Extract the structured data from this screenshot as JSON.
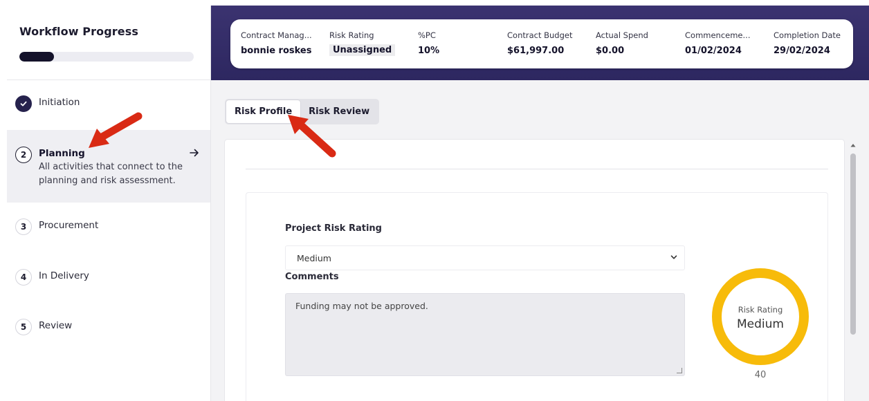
{
  "sidebar": {
    "title": "Workflow Progress",
    "progress_fraction": 0.2,
    "steps": [
      {
        "number": "1",
        "label": "Initiation",
        "state": "done"
      },
      {
        "number": "2",
        "label": "Planning",
        "state": "active",
        "description": "All activities that connect to the planning and risk assessment."
      },
      {
        "number": "3",
        "label": "Procurement",
        "state": "pending"
      },
      {
        "number": "4",
        "label": "In Delivery",
        "state": "pending"
      },
      {
        "number": "5",
        "label": "Review",
        "state": "pending"
      }
    ]
  },
  "header": {
    "fields": [
      {
        "label": "Contract Manag...",
        "value": "bonnie roskes"
      },
      {
        "label": "Risk Rating",
        "value": "Unassigned"
      },
      {
        "label": "%PC",
        "value": "10%"
      },
      {
        "label": "Contract Budget",
        "value": "$61,997.00"
      },
      {
        "label": "Actual Spend",
        "value": "$0.00"
      },
      {
        "label": "Commenceme...",
        "value": "01/02/2024"
      },
      {
        "label": "Completion Date",
        "value": "29/02/2024"
      }
    ]
  },
  "tabs": [
    {
      "label": "Risk Profile",
      "active": true
    },
    {
      "label": "Risk Review",
      "active": false
    }
  ],
  "form": {
    "risk_rating_label": "Project Risk Rating",
    "risk_rating_value": "Medium",
    "comments_label": "Comments",
    "comments_value": "Funding may not be approved."
  },
  "gauge": {
    "label": "Risk Rating",
    "value": "Medium",
    "score": "40",
    "color": "#f7bb0a"
  },
  "colors": {
    "accent_dark": "#26224d",
    "header_band": "#332d68",
    "annotation_red": "#d92a14"
  }
}
